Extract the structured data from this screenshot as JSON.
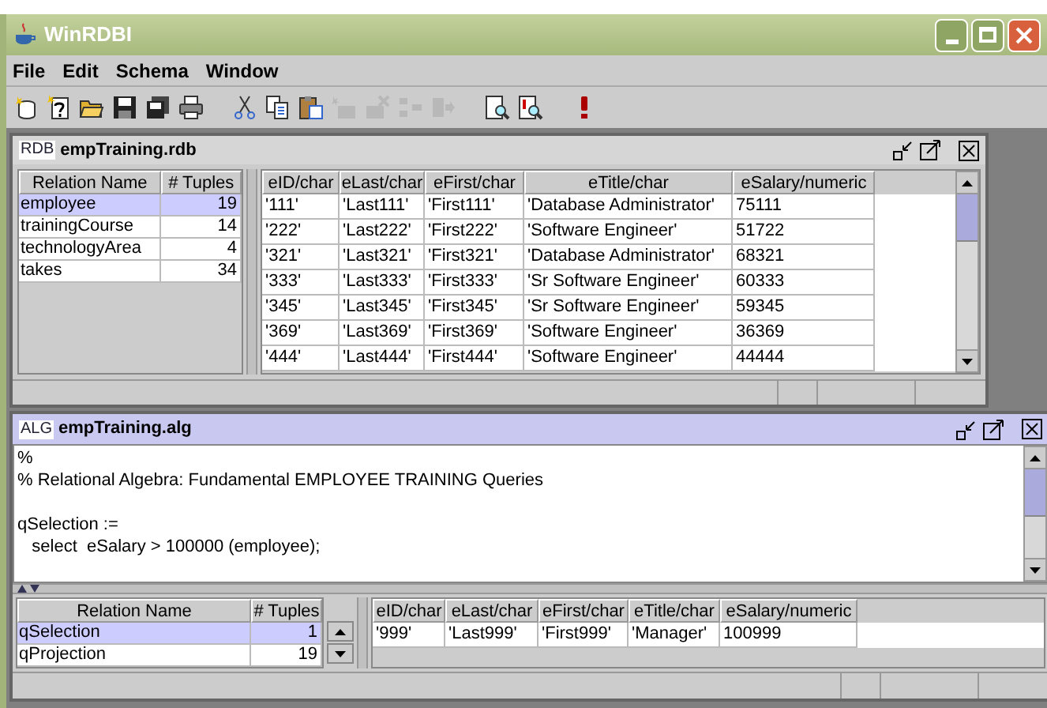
{
  "window": {
    "title": "WinRDBI"
  },
  "menu": [
    "File",
    "Edit",
    "Schema",
    "Window"
  ],
  "toolbar": [
    {
      "kind": "new-database",
      "disabled": false
    },
    {
      "kind": "new-query",
      "disabled": false
    },
    {
      "kind": "open",
      "disabled": false
    },
    {
      "kind": "save",
      "disabled": false
    },
    {
      "kind": "save-all",
      "disabled": false
    },
    {
      "kind": "print",
      "disabled": false
    },
    {
      "kind": "separator"
    },
    {
      "kind": "cut",
      "disabled": false
    },
    {
      "kind": "copy",
      "disabled": false
    },
    {
      "kind": "paste",
      "disabled": false
    },
    {
      "kind": "add-table",
      "disabled": true
    },
    {
      "kind": "delete-table",
      "disabled": true
    },
    {
      "kind": "join",
      "disabled": true
    },
    {
      "kind": "arrow",
      "disabled": true
    },
    {
      "kind": "separator"
    },
    {
      "kind": "preview",
      "disabled": false
    },
    {
      "kind": "preview-query",
      "disabled": false
    },
    {
      "kind": "separator"
    },
    {
      "kind": "execute",
      "disabled": false
    }
  ],
  "database_frame": {
    "badge": "RDB",
    "title": "empTraining.rdb",
    "active": false,
    "relations": {
      "columns": [
        "Relation Name",
        "# Tuples"
      ],
      "rows": [
        {
          "name": "employee",
          "tuples": "19",
          "selected": true
        },
        {
          "name": "trainingCourse",
          "tuples": "14",
          "selected": false
        },
        {
          "name": "technologyArea",
          "tuples": "4",
          "selected": false
        },
        {
          "name": "takes",
          "tuples": "34",
          "selected": false
        }
      ]
    },
    "table": {
      "columns": [
        "eID/char",
        "eLast/char",
        "eFirst/char",
        "eTitle/char",
        "eSalary/numeric"
      ],
      "rows": [
        [
          "'111'",
          "'Last111'",
          "'First111'",
          "'Database Administrator'",
          "75111"
        ],
        [
          "'222'",
          "'Last222'",
          "'First222'",
          "'Software Engineer'",
          "51722"
        ],
        [
          "'321'",
          "'Last321'",
          "'First321'",
          "'Database Administrator'",
          "68321"
        ],
        [
          "'333'",
          "'Last333'",
          "'First333'",
          "'Sr Software Engineer'",
          "60333"
        ],
        [
          "'345'",
          "'Last345'",
          "'First345'",
          "'Sr Software Engineer'",
          "59345"
        ],
        [
          "'369'",
          "'Last369'",
          "'First369'",
          "'Software Engineer'",
          "36369"
        ],
        [
          "'444'",
          "'Last444'",
          "'First444'",
          "'Software Engineer'",
          "44444"
        ]
      ]
    }
  },
  "query_frame": {
    "badge": "ALG",
    "title": "empTraining.alg",
    "active": true,
    "editor_paragraphs": [
      [
        "%",
        "% Relational Algebra: Fundamental EMPLOYEE TRAINING Queries"
      ],
      [
        "qSelection :=",
        "   select  eSalary > 100000 (employee);"
      ]
    ],
    "relations": {
      "columns": [
        "Relation Name",
        "# Tuples"
      ],
      "rows": [
        {
          "name": "qSelection",
          "tuples": "1",
          "selected": true
        },
        {
          "name": "qProjection",
          "tuples": "19",
          "selected": false
        }
      ]
    },
    "result": {
      "columns": [
        "eID/char",
        "eLast/char",
        "eFirst/char",
        "eTitle/char",
        "eSalary/numeric"
      ],
      "rows": [
        [
          "'999'",
          "'Last999'",
          "'First999'",
          "'Manager'",
          "100999"
        ]
      ]
    }
  }
}
